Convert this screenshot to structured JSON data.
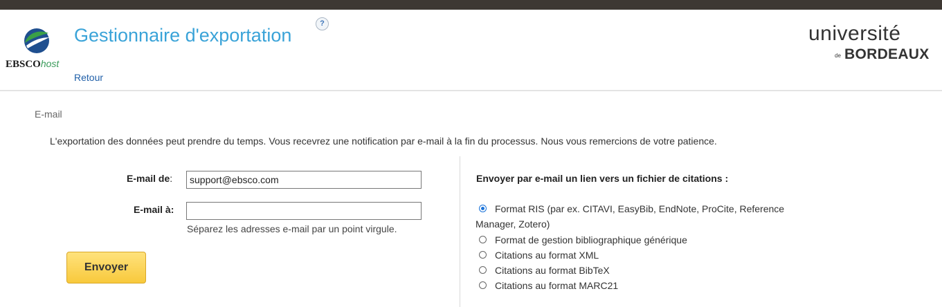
{
  "header": {
    "ebsco_brand": "EBSCO",
    "ebsco_host": "host",
    "title": "Gestionnaire d'exportation",
    "help_symbol": "?",
    "back_link": "Retour",
    "university_line1": "université",
    "university_de": "de",
    "university_line2": "BORDEAUX"
  },
  "section": {
    "label": "E-mail",
    "notice": "L'exportation des données peut prendre du temps. Vous recevrez une notification par e-mail à la fin du processus. Nous vous remercions de votre patience."
  },
  "form": {
    "from_label": "E-mail de",
    "from_colon": ":",
    "from_value": "support@ebsco.com",
    "to_label": "E-mail à:",
    "to_value": "",
    "hint": "Séparez les adresses e-mail par un point virgule.",
    "send_button": "Envoyer"
  },
  "formats": {
    "title": "Envoyer par e-mail un lien vers un fichier de citations :",
    "selected_index": 0,
    "options": [
      {
        "label_line1": "Format RIS (par ex. CITAVI, EasyBib, EndNote, ProCite, Reference",
        "label_line2": "Manager, Zotero)"
      },
      {
        "label_line1": "Format de gestion bibliographique générique"
      },
      {
        "label_line1": "Citations au format XML"
      },
      {
        "label_line1": "Citations au format BibTeX"
      },
      {
        "label_line1": "Citations au format MARC21"
      }
    ]
  },
  "colors": {
    "title_blue": "#3aa3d8",
    "link_blue": "#1f5fa8",
    "button_yellow": "#f8c93c",
    "topbar": "#3d3833"
  }
}
